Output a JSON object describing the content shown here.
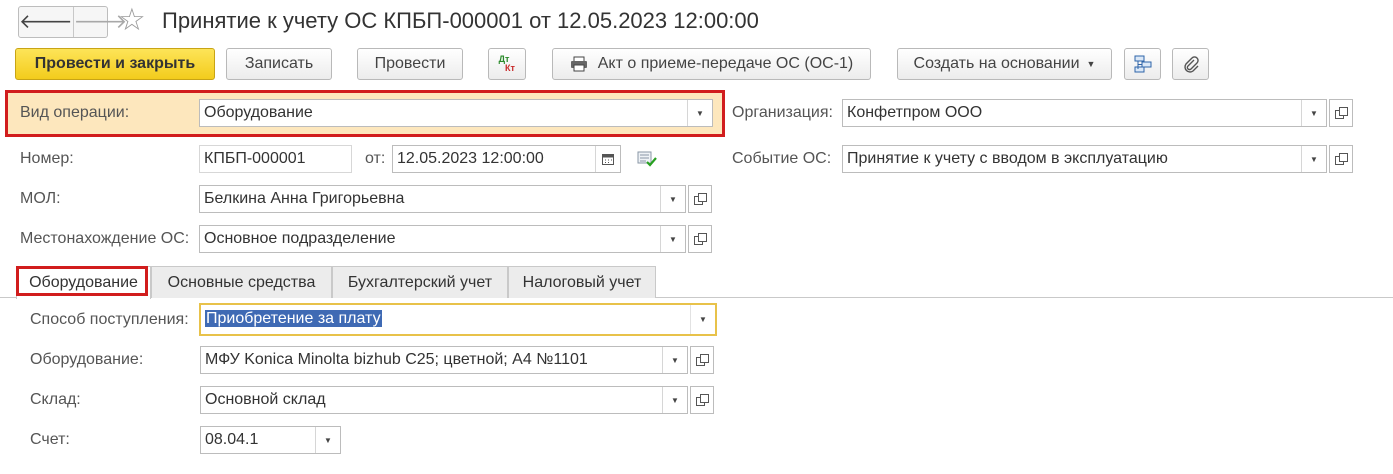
{
  "window": {
    "title": "Принятие к учету ОС КПБП-000001 от 12.05.2023 12:00:00",
    "back_glyph": "🡐",
    "forward_glyph": "🡒",
    "star_glyph": "☆"
  },
  "toolbar": {
    "post_and_close": "Провести и закрыть",
    "save": "Записать",
    "post": "Провести",
    "dtkt_top": "Дт",
    "dtkt_bottom": "Кт",
    "act_print": "Акт о приеме-передаче ОС (ОС-1)",
    "create_based_on": "Создать на основании"
  },
  "header": {
    "operation_type_label": "Вид операции:",
    "operation_type_value": "Оборудование",
    "organization_label": "Организация:",
    "organization_value": "Конфетпром ООО",
    "number_label": "Номер:",
    "number_value": "КПБП-000001",
    "date_label": "от:",
    "date_value": "12.05.2023 12:00:00",
    "event_label": "Событие ОС:",
    "event_value": "Принятие к учету с вводом в эксплуатацию",
    "mol_label": "МОЛ:",
    "mol_value": "Белкина Анна Григорьевна",
    "location_label": "Местонахождение ОС:",
    "location_value": "Основное подразделение"
  },
  "tabs": [
    {
      "label": "Оборудование",
      "active": true
    },
    {
      "label": "Основные средства",
      "active": false
    },
    {
      "label": "Бухгалтерский учет",
      "active": false
    },
    {
      "label": "Налоговый учет",
      "active": false
    }
  ],
  "equipment_tab": {
    "receipt_method_label": "Способ поступления:",
    "receipt_method_value": "Приобретение за плату",
    "equipment_label": "Оборудование:",
    "equipment_value": "МФУ Konica Minolta bizhub C25; цветной; A4  №1101",
    "warehouse_label": "Склад:",
    "warehouse_value": "Основной склад",
    "account_label": "Счет:",
    "account_value": "08.04.1"
  },
  "colors": {
    "primary_button": "#f3cc1c",
    "highlight_frame": "#d11d1d",
    "operation_type_bg": "#fde7bd",
    "focused_field_border": "#e8c24a",
    "selection": "#3f6ab4"
  },
  "icons": [
    "back-arrow-icon",
    "forward-arrow-icon",
    "favorite-star-icon",
    "dt-kt-icon",
    "printer-icon",
    "dropdown-arrow-icon",
    "structure-icon",
    "paperclip-icon",
    "calendar-icon",
    "check-document-icon",
    "open-form-icon"
  ]
}
